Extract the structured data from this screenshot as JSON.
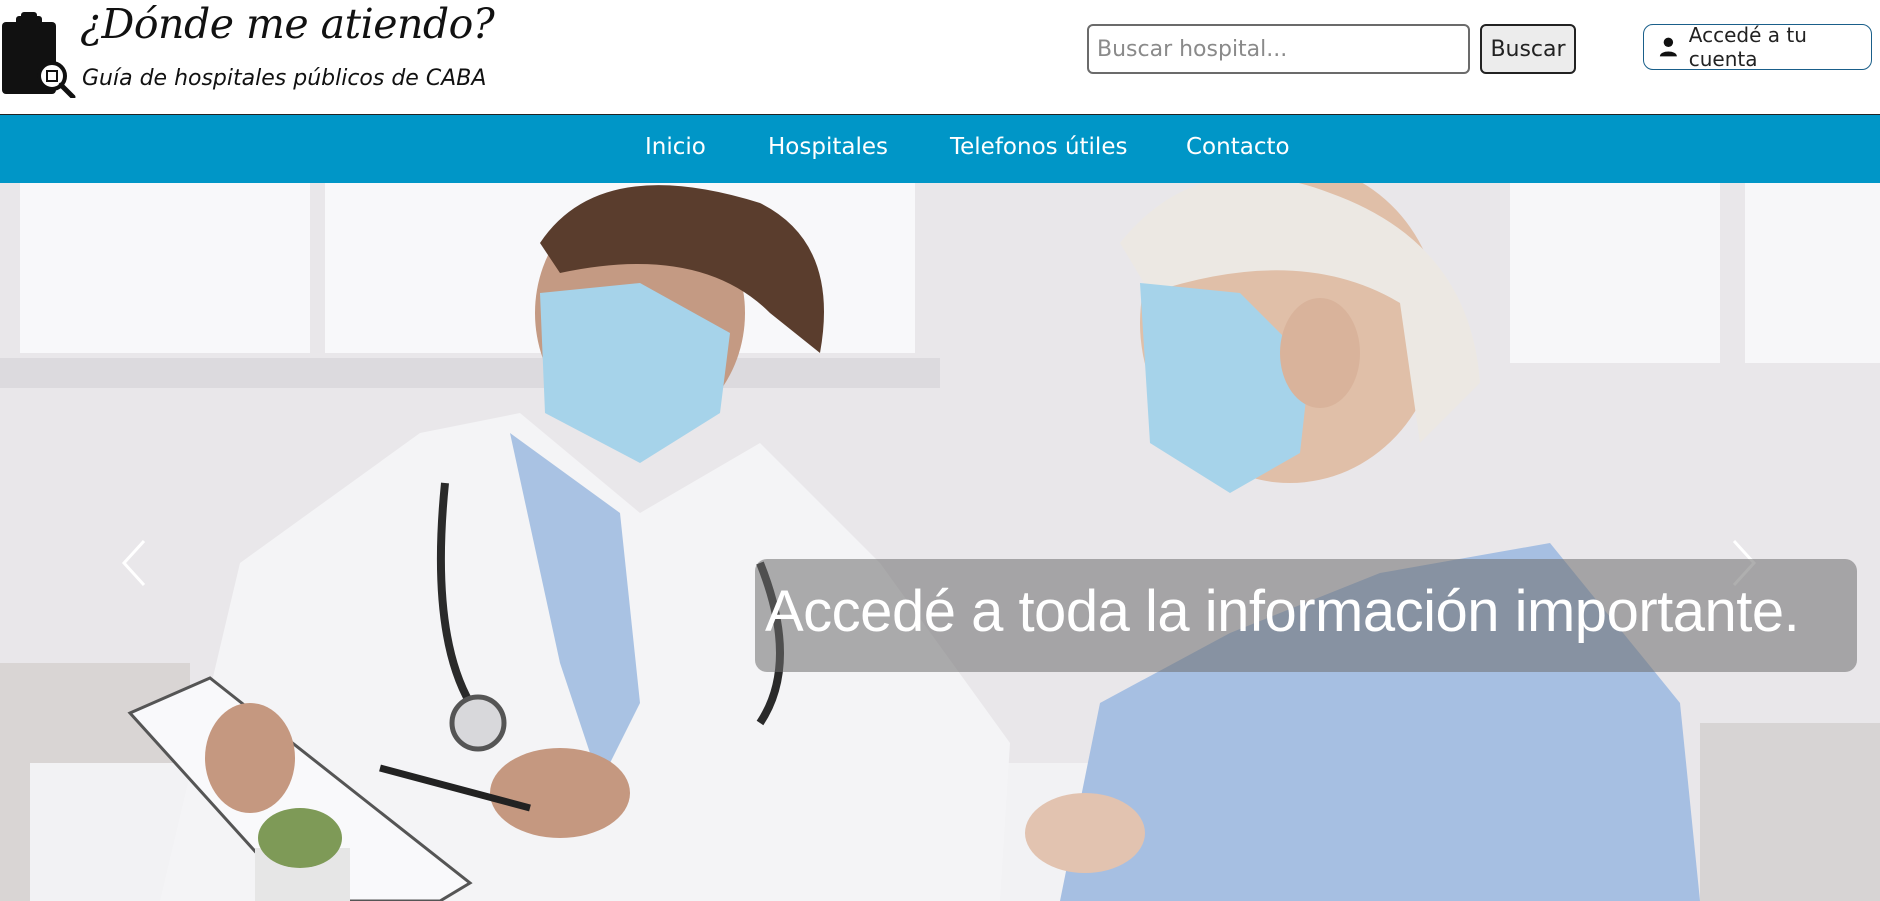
{
  "brand": {
    "title": "¿Dónde me atiendo?",
    "subtitle": "Guía de hospitales públicos de CABA",
    "logo_icon": "clipboard-magnifier-icon"
  },
  "search": {
    "placeholder": "Buscar hospital...",
    "value": "",
    "button_label": "Buscar"
  },
  "account": {
    "label": "Accedé a tu cuenta",
    "icon": "user-icon"
  },
  "nav": {
    "items": [
      {
        "label": "Inicio"
      },
      {
        "label": "Hospitales"
      },
      {
        "label": "Telefonos útiles"
      },
      {
        "label": "Contacto"
      }
    ],
    "background": "#0096c7"
  },
  "hero": {
    "caption": "Accedé a toda la información importante.",
    "prev_icon": "chevron-left-icon",
    "next_icon": "chevron-right-icon",
    "image_subject": "doctor-and-patient-photo"
  }
}
